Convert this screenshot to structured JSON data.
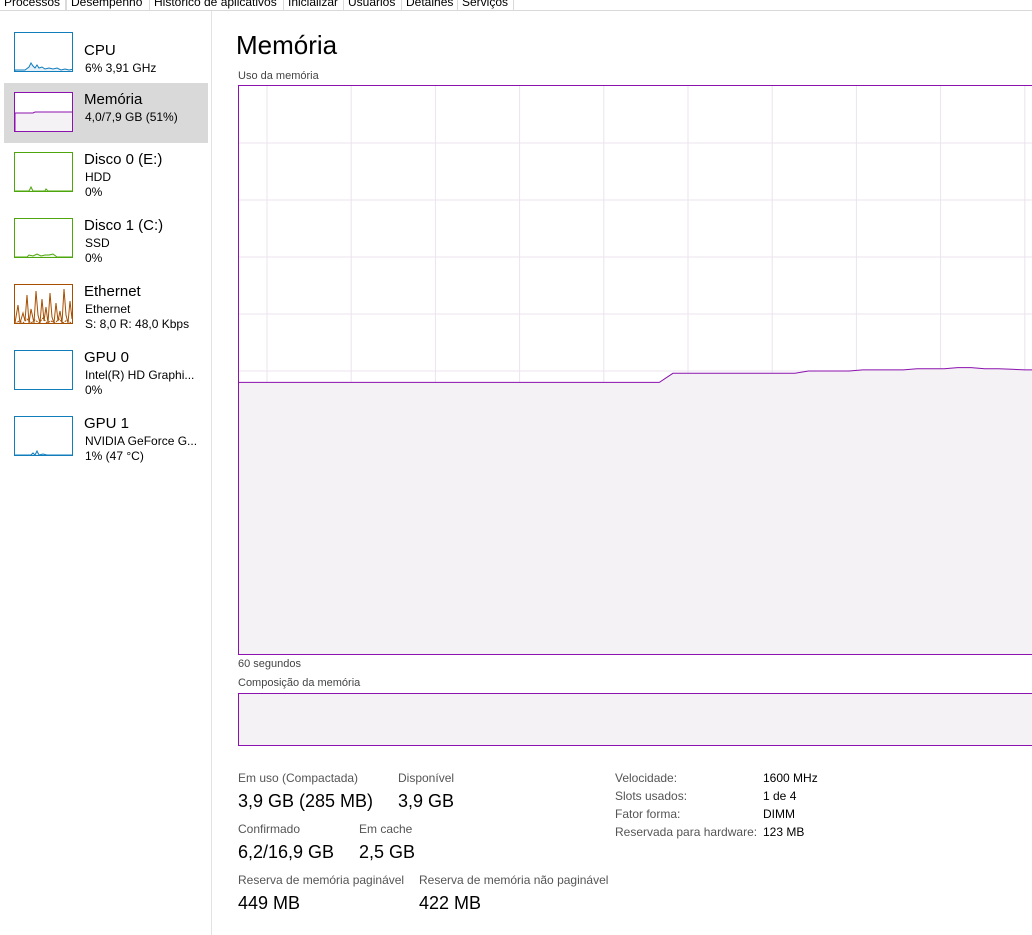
{
  "tabs": [
    "Processos",
    "Desempenho",
    "Histórico de aplicativos",
    "Inicializar",
    "Usuários",
    "Detalhes",
    "Serviços"
  ],
  "sidebar": {
    "items": [
      {
        "title": "CPU",
        "line1": "6% 3,91 GHz",
        "line2": "",
        "color": "#117dbb"
      },
      {
        "title": "Memória",
        "line1": "4,0/7,9 GB (51%)",
        "line2": "",
        "color": "#8b12ae"
      },
      {
        "title": "Disco 0 (E:)",
        "line1": "HDD",
        "line2": "0%",
        "color": "#4da60c"
      },
      {
        "title": "Disco 1 (C:)",
        "line1": "SSD",
        "line2": "0%",
        "color": "#4da60c"
      },
      {
        "title": "Ethernet",
        "line1": "Ethernet",
        "line2": "S: 8,0  R: 48,0 Kbps",
        "color": "#a74f01"
      },
      {
        "title": "GPU 0",
        "line1": "Intel(R) HD Graphi...",
        "line2": "0%",
        "color": "#117dbb"
      },
      {
        "title": "GPU 1",
        "line1": "NVIDIA GeForce G...",
        "line2": "1% (47 °C)",
        "color": "#117dbb"
      }
    ]
  },
  "main": {
    "title": "Memória",
    "graph_label": "Uso da memória",
    "time_label": "60 segundos",
    "composition_label": "Composição da memória"
  },
  "stats": {
    "in_use_label": "Em uso (Compactada)",
    "in_use_value": "3,9 GB (285 MB)",
    "available_label": "Disponível",
    "available_value": "3,9 GB",
    "committed_label": "Confirmado",
    "committed_value": "6,2/16,9 GB",
    "cached_label": "Em cache",
    "cached_value": "2,5 GB",
    "paged_label": "Reserva de memória paginável",
    "paged_value": "449 MB",
    "nonpaged_label": "Reserva de memória não paginável",
    "nonpaged_value": "422 MB"
  },
  "specs": [
    {
      "label": "Velocidade:",
      "value": "1600 MHz"
    },
    {
      "label": "Slots usados:",
      "value": "1 de 4"
    },
    {
      "label": "Fator forma:",
      "value": "DIMM"
    },
    {
      "label": "Reservada para hardware:",
      "value": "123 MB"
    }
  ],
  "memory_usage_series": {
    "unit": "% of total memory",
    "values": [
      48,
      48,
      48,
      48,
      48,
      48,
      48,
      48,
      48,
      48,
      48,
      48,
      48,
      48,
      48,
      48,
      48,
      48,
      48,
      48,
      48,
      48,
      48,
      48,
      48,
      48,
      48,
      48,
      48,
      48,
      48,
      48,
      49.6,
      49.6,
      49.6,
      49.6,
      49.6,
      49.6,
      49.6,
      49.6,
      49.6,
      49.6,
      50,
      50,
      50,
      50,
      50.2,
      50.2,
      50.2,
      50.2,
      50.4,
      50.4,
      50.4,
      50.6,
      50.6,
      50.4,
      50.4,
      50.3,
      50.2,
      50.2
    ]
  },
  "colors": {
    "memory": "#8b12ae",
    "memory_fill": "#f4f2f4",
    "cpu": "#117dbb",
    "disk": "#4da60c",
    "ethernet": "#a74f01",
    "selected_bg": "#d9d9d9"
  }
}
